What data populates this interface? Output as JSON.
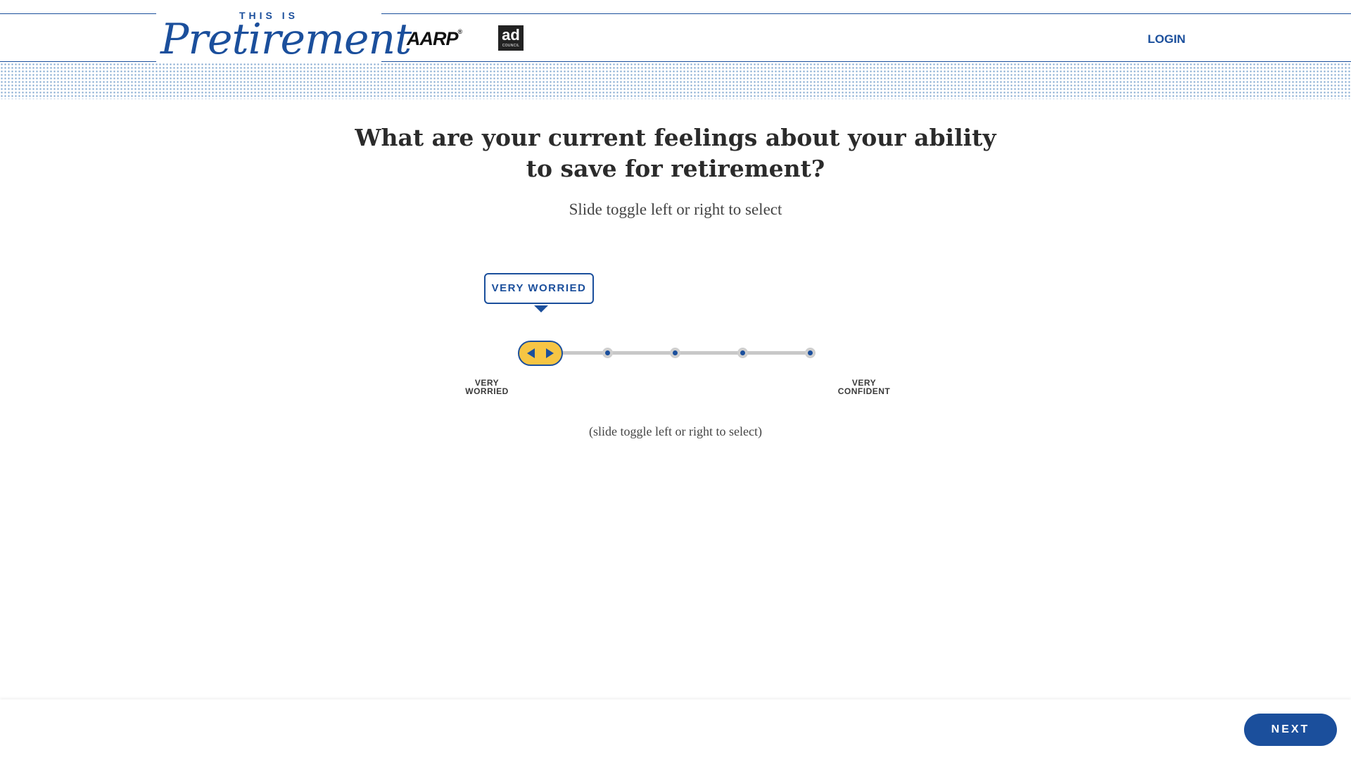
{
  "header": {
    "logo_top": "THIS IS",
    "logo_main": "Pretirement",
    "partner_aarp": "AARP",
    "partner_aarp_reg": "®",
    "partner_adcouncil_ad": "ad",
    "partner_adcouncil_small": "COUNCIL",
    "login_label": "LOGIN"
  },
  "question": {
    "line1": "What are your current feelings about your ability",
    "line2": "to save for retirement?",
    "subtitle": "Slide toggle left or right to select"
  },
  "slider": {
    "selected_label": "VERY WORRIED",
    "selected_index": 0,
    "stop_count": 5,
    "left_label_line1": "VERY",
    "left_label_line2": "WORRIED",
    "right_label_line1": "VERY",
    "right_label_line2": "CONFIDENT",
    "hint": "(slide toggle left or right to select)"
  },
  "footer": {
    "next_label": "NEXT"
  },
  "colors": {
    "brand_blue": "#1b4f9c",
    "thumb_yellow": "#f6c544",
    "track_gray": "#c8c8c8",
    "text_dark": "#2b2b2b"
  },
  "icons": {
    "thumb_left": "triangle-left-icon",
    "thumb_right": "triangle-right-icon"
  }
}
